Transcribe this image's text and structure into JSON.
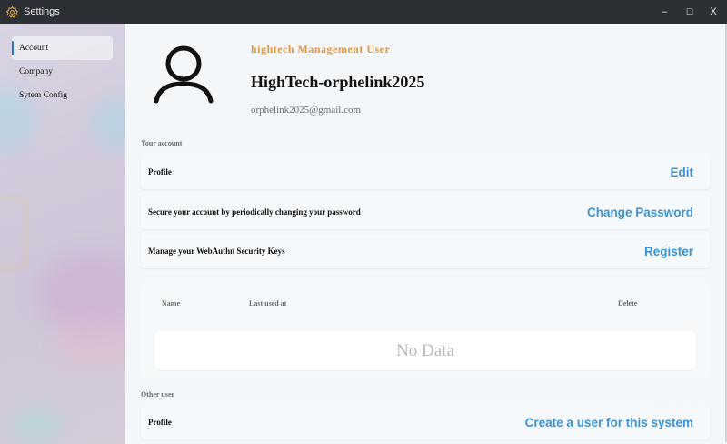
{
  "window": {
    "title": "Settings",
    "controls": [
      "–",
      "☐",
      "X"
    ]
  },
  "sidebar": {
    "items": [
      {
        "label": "Account",
        "active": true
      },
      {
        "label": "Company",
        "active": false
      },
      {
        "label": "Sytem Config",
        "active": false
      }
    ]
  },
  "profile": {
    "role": "hightech Management User",
    "username": "HighTech-orphelink2025",
    "email": "orphelink2025@gmail.com"
  },
  "your_account": {
    "label": "Your account",
    "rows": [
      {
        "label": "Profile",
        "action": "Edit"
      },
      {
        "label": "Secure your account by periodically changing your password",
        "action": "Change Password"
      },
      {
        "label": "Manage your WebAuthn Security Keys",
        "action": "Register"
      }
    ],
    "keys_table": {
      "columns": [
        "Name",
        "Last used at",
        "Delete"
      ],
      "empty_text": "No Data"
    }
  },
  "other_user": {
    "label": "Other user",
    "rows": [
      {
        "label": "Profile",
        "action": "Create a user for this system"
      }
    ]
  },
  "colors": {
    "accent": "#3a93d6",
    "role": "#e6973c",
    "active_indicator": "#2b6fd6"
  },
  "icons": {
    "app": "gear-icon",
    "avatar": "user-icon"
  }
}
